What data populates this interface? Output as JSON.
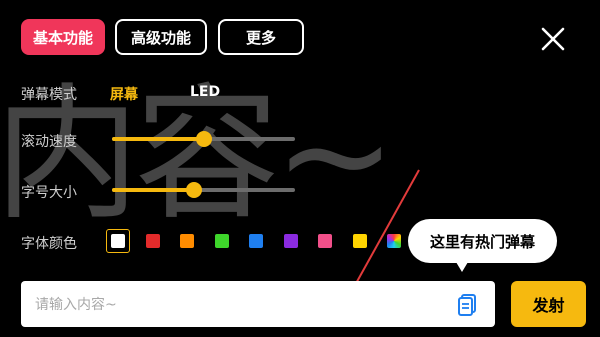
{
  "background_text": "内容~",
  "tabs": [
    {
      "label": "基本功能",
      "active": true
    },
    {
      "label": "高级功能",
      "active": false
    },
    {
      "label": "更多",
      "active": false
    }
  ],
  "close_icon": "close-icon",
  "settings": {
    "mode_label": "弹幕模式",
    "mode_options": [
      {
        "label": "屏幕",
        "selected": true,
        "color": "#f6b90f"
      },
      {
        "label": "LED",
        "selected": false,
        "color": "#ffffff"
      }
    ],
    "speed_label": "滚动速度",
    "speed_value": 0.5,
    "size_label": "字号大小",
    "size_value": 0.45,
    "color_label": "字体颜色",
    "colors": [
      "#ffffff",
      "#e32b2b",
      "#ff8c00",
      "#3ed62b",
      "#1f7ff0",
      "#8b2be0",
      "#f2508a",
      "#ffd400",
      "rainbow"
    ],
    "selected_color_index": 0
  },
  "tooltip": "这里有热门弹幕",
  "input": {
    "placeholder": "请输入内容~",
    "value": ""
  },
  "hot_icon": "danmaku-list-icon",
  "send_label": "发射",
  "accent_color": "#f6b90f",
  "brand_color": "#f0365a"
}
